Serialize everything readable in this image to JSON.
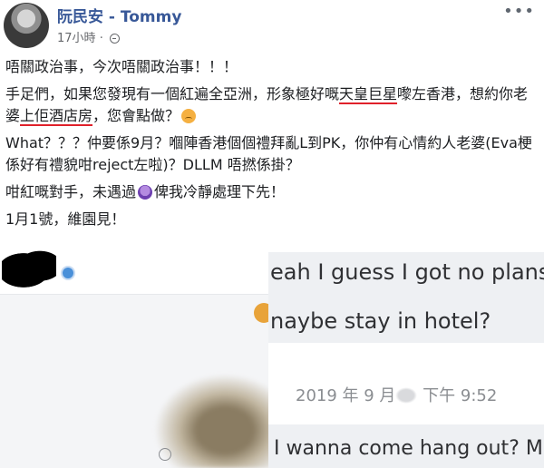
{
  "post": {
    "author": "阮民安 - Tommy",
    "time": "17小時",
    "separator": "·",
    "privacy_icon": "globe-icon",
    "more_icon": "more-horizontal-icon",
    "paragraphs": {
      "p1": "唔關政治事，今次唔關政治事！！！",
      "p2_a": "手足們，如果您發現有一個紅遍全亞洲，形象極好嘅",
      "p2_u1": "天皇巨星",
      "p2_b": "嚟左香港，想約你老婆",
      "p2_u2": "上佢酒店房",
      "p2_c": "，您會點做？",
      "p3_a": "What？？？仲要係9月？嗰陣香港個個禮拜亂L到PK，你仲有心情約人老婆(Eva梗係好有禮貌咁reject左啦)？DLLM 唔撚係掛？",
      "p4_a": "咁紅嘅對手，未遇過",
      "p4_b": "俾我冷靜處理下先！",
      "p5": "1月1號，維園見！"
    },
    "emoji": {
      "sad": "sad-face-icon",
      "angry": "angry-face-icon"
    },
    "underline_color": "#e0202a"
  },
  "screenshot": {
    "line1": "eah I guess I got no plans,",
    "line2": "naybe stay in hotel?",
    "timestamp_a": "2019 年 9 月",
    "timestamp_b": "下午 9:52",
    "line3": "I wanna come hang out? M"
  },
  "colors": {
    "author": "#385898",
    "meta": "#65676b",
    "text": "#1c1e21"
  }
}
